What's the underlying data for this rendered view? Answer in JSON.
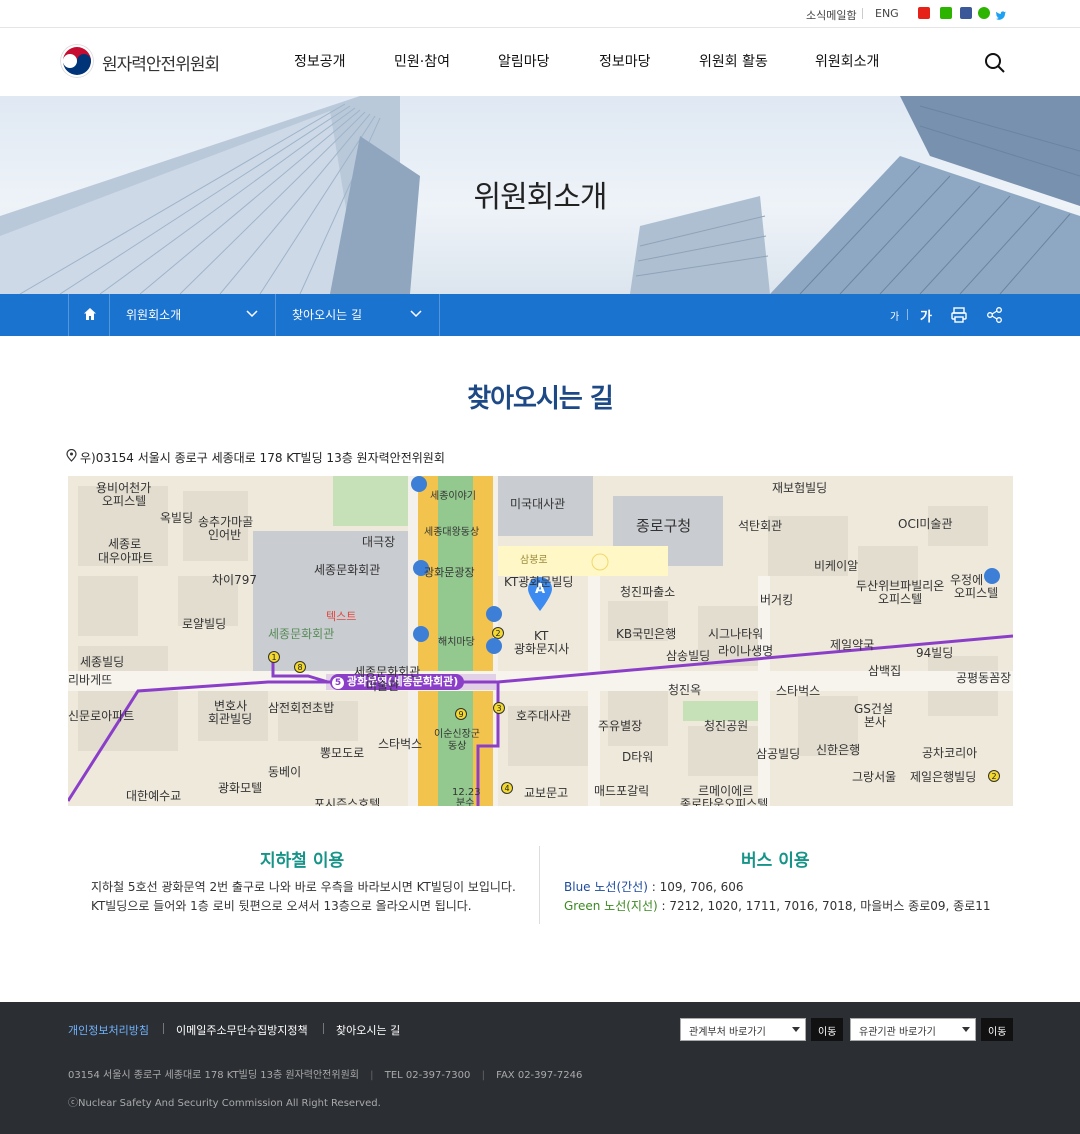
{
  "utility": {
    "news_mail": "소식메일함",
    "eng": "ENG",
    "sns": [
      "youtube-icon",
      "blog-icon",
      "facebook-icon",
      "post-icon",
      "twitter-icon"
    ]
  },
  "header": {
    "logo_text": "원자력안전위원회",
    "nav": [
      "정보공개",
      "민원·참여",
      "알림마당",
      "정보마당",
      "위원회 활동",
      "위원회소개"
    ]
  },
  "visual": {
    "title": "위원회소개"
  },
  "location": {
    "menu1": "위원회소개",
    "menu2": "찾아오시는 길",
    "font_small": "가",
    "font_large": "가"
  },
  "content": {
    "title": "찾아오시는 길",
    "address": "우)03154 서울시 종로구 세종대로 178 KT빌딩 13층 원자력안전위원회"
  },
  "map": {
    "labels": {
      "l01": "용비어천가",
      "l02": "오피스텔",
      "l03": "옥빌딩",
      "l04": "송추가마골",
      "l05": "인어반",
      "l06": "세종로",
      "l07": "대우아파트",
      "l08": "차이797",
      "l09": "대극장",
      "l10": "세종문화회관",
      "l11": "로얄빌딩",
      "l12": "텍스트",
      "l13": "세종문화회관",
      "l14": "세종빌딩",
      "l15": "리바게뜨",
      "l16": "신문로아파트",
      "l17": "변호사",
      "l18": "회관빌딩",
      "l19": "삼전회전초밥",
      "l20": "동베이",
      "l21": "뽕모도로",
      "l22": "스타벅스",
      "l23": "광화모텔",
      "l24": "대한예수교",
      "l25": "세종이야기",
      "l26": "세종대왕동상",
      "l27": "광화문광장",
      "l28": "해치마당",
      "l29": "이순신장군",
      "l30": "동상",
      "l31": "미국대사관",
      "l32": "삼봉로",
      "l33": "KT광화문빌딩",
      "l34": "KT",
      "l35": "광화문지사",
      "l36": "호주대사관",
      "l37": "교보문고",
      "l38": "종로구청",
      "l39": "청진파출소",
      "l40": "KB국민은행",
      "l41": "삼송빌딩",
      "l42": "청진옥",
      "l43": "주유별장",
      "l44": "D타워",
      "l45": "매드포갈릭",
      "l46": "재보험빌딩",
      "l47": "석탄회관",
      "l48": "시그나타워",
      "l49": "라이나생명",
      "l50": "청진공원",
      "l51": "스타벅스",
      "l52": "삼공빌딩",
      "l53": "르메이에르",
      "l54": "종로타운오피스텔",
      "l55": "비케이알",
      "l56": "버거킹",
      "l57": "제일약국",
      "l58": "신한은행",
      "l59": "OCI미술관",
      "l60": "두산위브파빌리온",
      "l61": "오피스텔",
      "l62": "우정에",
      "l63": "오피스텔",
      "l64": "94빌딩",
      "l65": "삼백집",
      "l66": "공평동꼼장",
      "l67": "GS건설",
      "l68": "본사",
      "l69": "공차코리아",
      "l70": "그랑서울",
      "l71": "제일은행빌딩",
      "l72": "12.23",
      "l73": "분수",
      "l74": "포시즌스호텔",
      "l75": "세종문화회관",
      "l76": "미술관"
    },
    "station_label": "광화문역(세종문화회관)",
    "station_line": "5",
    "marker": "A",
    "exits": [
      "1",
      "8",
      "2",
      "3",
      "9",
      "4",
      "2"
    ]
  },
  "subway": {
    "title": "지하철 이용",
    "line1": "지하철 5호선 광화문역 2번 출구로 나와 바로 우측을 바라보시면 KT빌딩이 보입니다.",
    "line2": "KT빌딩으로 들어와 1층 로비 뒷편으로 오셔서 13층으로 올라오시면 됩니다."
  },
  "bus": {
    "title": "버스 이용",
    "blue_label": "Blue 노선(간선)",
    "blue_routes": " : 109, 706, 606",
    "green_label": "Green 노선(지선)",
    "green_routes": " : 7212, 1020, 1711, 7016, 7018, 마을버스 종로09, 종로11"
  },
  "footer": {
    "privacy": "개인정보처리방침",
    "email_policy": "이메일주소무단수집방지정책",
    "directions": "찾아오시는 길",
    "select1": "관계부처 바로가기",
    "select2": "유관기관 바로가기",
    "go": "이동",
    "address": "03154 서울시 종로구 세종대로 178 KT빌딩 13층 원자력안전위원회",
    "tel": "TEL 02-397-7300",
    "fax": "FAX 02-397-7246",
    "copyright": "ⓒNuclear Safety And Security Commission All Right Reserved."
  },
  "colors": {
    "brand_blue": "#1a73cf",
    "title_navy": "#1d4a86",
    "teal": "#179488",
    "footer_bg": "#2b2e33",
    "subway_purple": "#8b3fc9"
  }
}
